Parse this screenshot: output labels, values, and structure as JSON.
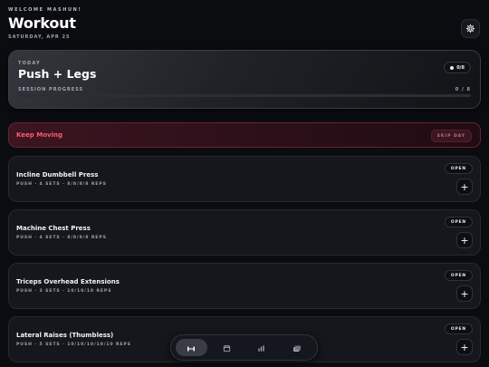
{
  "header": {
    "welcome": "WELCOME MASHUN!",
    "title": "Workout",
    "date": "SATURDAY, APR 25",
    "settings_icon": "gear-icon"
  },
  "today": {
    "label": "TODAY",
    "title": "Push + Legs",
    "count": "0/8",
    "progress_label": "SESSION PROGRESS",
    "progress_value": "0 / 8",
    "progress_fraction": 0
  },
  "keep_moving": {
    "label": "Keep Moving",
    "skip_label": "SKIP DAY"
  },
  "exercises": [
    {
      "name": "Incline Dumbbell Press",
      "meta": "PUSH · 4 SETS · 8/8/8/8 REPS",
      "open_label": "OPEN",
      "add_label": "+"
    },
    {
      "name": "Machine Chest Press",
      "meta": "PUSH · 4 SETS · 8/8/8/8 REPS",
      "open_label": "OPEN",
      "add_label": "+"
    },
    {
      "name": "Triceps Overhead Extensions",
      "meta": "PUSH · 3 SETS · 10/10/10 REPS",
      "open_label": "OPEN",
      "add_label": "+"
    },
    {
      "name": "Lateral Raises (Thumbless)",
      "meta": "PUSH · 5 SETS · 10/10/10/10/10 REPS",
      "open_label": "OPEN",
      "add_label": "+"
    }
  ],
  "nav": {
    "items": [
      {
        "icon": "dumbbell-icon",
        "active": true
      },
      {
        "icon": "calendar-icon",
        "active": false
      },
      {
        "icon": "bar-chart-icon",
        "active": false
      },
      {
        "icon": "stacked-cards-icon",
        "active": false
      }
    ]
  },
  "colors": {
    "accent_red": "#ff5a73",
    "background": "#0b0c10"
  }
}
